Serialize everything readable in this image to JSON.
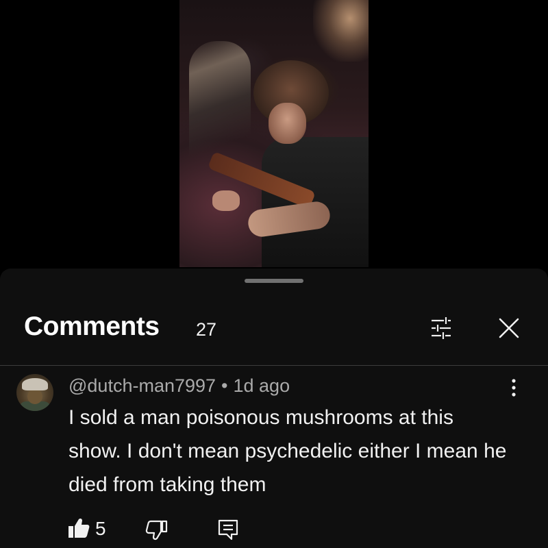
{
  "sheet": {
    "title": "Comments",
    "count": "27",
    "icons": [
      "filter-icon",
      "close-icon"
    ]
  },
  "comment": {
    "author": "@dutch-man7997",
    "separator": "•",
    "time": "1d ago",
    "text": "I sold a man poisonous mushrooms at this show. I don't mean psychedelic either I mean he died from taking them",
    "likes": "5",
    "icons": [
      "like-icon",
      "dislike-icon",
      "reply-icon",
      "more-options-icon"
    ]
  },
  "colors": {
    "sheet_bg": "#0f0f0f",
    "primary_text": "#f1f1f1",
    "secondary_text": "#aaaaaa",
    "divider": "#3d3d3d"
  }
}
